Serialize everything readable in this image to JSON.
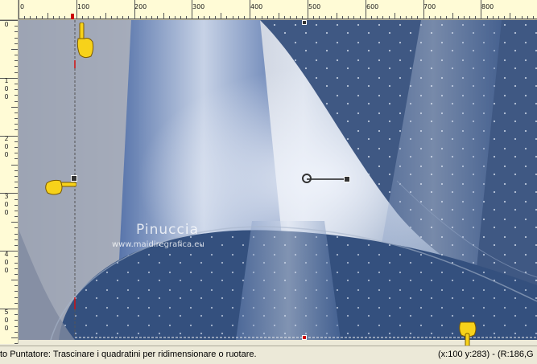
{
  "ruler": {
    "top_labels": [
      "0",
      "100",
      "200",
      "300",
      "400",
      "500",
      "600",
      "700",
      "800"
    ],
    "left_labels": [
      "0",
      "100",
      "200",
      "300",
      "400",
      "500"
    ]
  },
  "canvas": {
    "watermark_name": "Pinuccia",
    "watermark_url": "www.maidiregrafica.eu",
    "colors": {
      "dark_blue": "#2f4a7a",
      "light_gray_blue": "#c9d2e0",
      "mid_blue": "#5f7eae"
    }
  },
  "statusbar": {
    "tool_hint": "to Puntatore: Trascinare i quadratini per ridimensionare o ruotare.",
    "coordinates": "(x:100 y:283) - (R:186,G"
  },
  "icons": [
    "pointing-hand-icon",
    "resize-handle-icon",
    "rotation-handle-icon"
  ]
}
